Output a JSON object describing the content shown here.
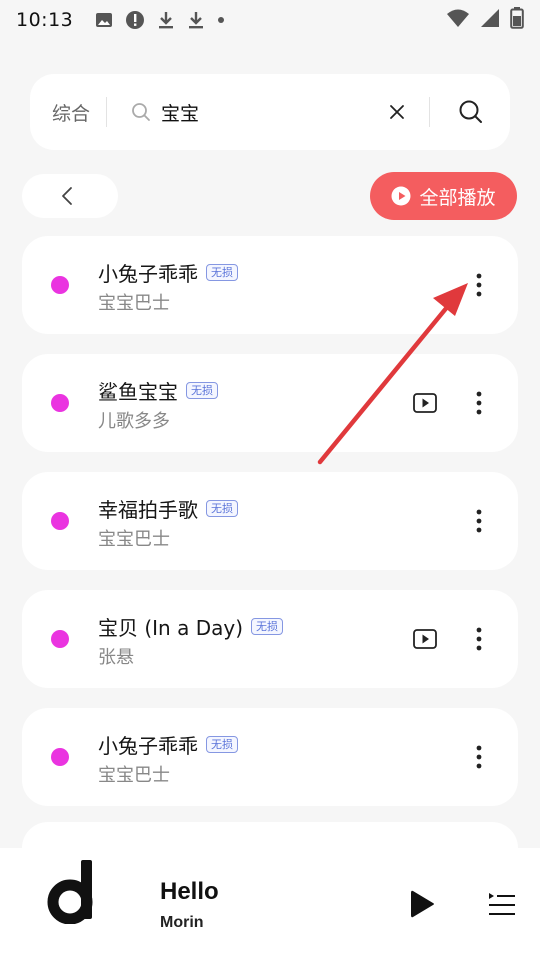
{
  "status_bar": {
    "time": "10:13",
    "icons": [
      "image-icon",
      "alert-icon",
      "download-icon",
      "download-icon",
      "dot-icon"
    ],
    "right_icons": [
      "wifi-icon",
      "signal-icon",
      "battery-icon"
    ]
  },
  "search": {
    "scope": "综合",
    "query": "宝宝"
  },
  "toolbar": {
    "play_all_label": "全部播放"
  },
  "songs": [
    {
      "title": "小兔子乖乖",
      "artist": "宝宝巴士",
      "badge": "无损",
      "has_mv": false
    },
    {
      "title": "鲨鱼宝宝",
      "artist": "儿歌多多",
      "badge": "无损",
      "has_mv": true
    },
    {
      "title": "幸福拍手歌",
      "artist": "宝宝巴士",
      "badge": "无损",
      "has_mv": false
    },
    {
      "title": "宝贝 (In a Day)",
      "artist": "张悬",
      "badge": "无损",
      "has_mv": true
    },
    {
      "title": "小兔子乖乖",
      "artist": "宝宝巴士",
      "badge": "无损",
      "has_mv": false
    }
  ],
  "player": {
    "title": "Hello",
    "artist": "Morin"
  },
  "colors": {
    "accent": "#f45d5f",
    "dot": "#ea34e0",
    "badge": "#5b74d9",
    "annotation": "#e0393c"
  }
}
